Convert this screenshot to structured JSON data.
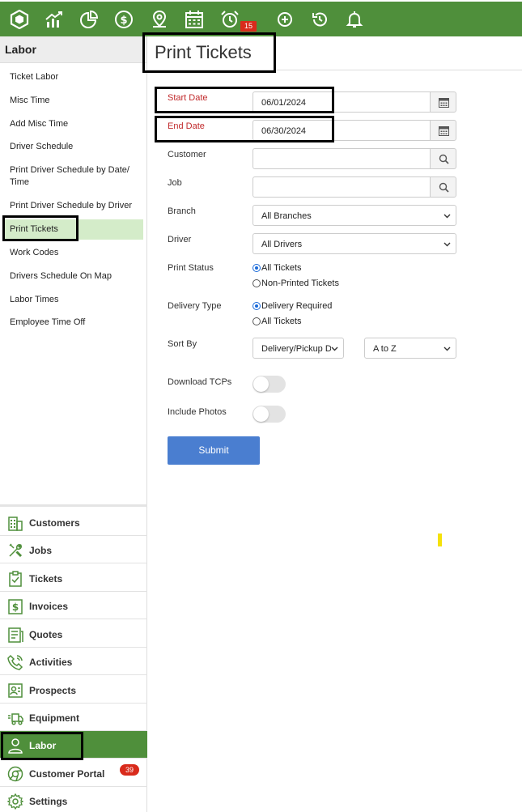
{
  "topbar": {
    "icons": [
      "logo-hexagon-icon",
      "chart-trend-icon",
      "pie-chart-icon",
      "dollar-circle-icon",
      "map-pin-icon",
      "calendar-icon",
      "alarm-clock-icon",
      "plus-circle-icon",
      "history-icon",
      "bell-icon"
    ],
    "alarm_badge": "15",
    "color": "#4f8f3b"
  },
  "sidebar": {
    "header": "Labor",
    "links": [
      "Ticket Labor",
      "Misc Time",
      "Add Misc Time",
      "Driver Schedule",
      "Print Driver Schedule by Date/ Time",
      "Print Driver Schedule by Driver",
      "Print Tickets",
      "Work Codes",
      "Drivers Schedule On Map",
      "Labor Times",
      "Employee Time Off"
    ],
    "active_link": "Print Tickets"
  },
  "modules": {
    "items": [
      "Customers",
      "Jobs",
      "Tickets",
      "Invoices",
      "Quotes",
      "Activities",
      "Prospects",
      "Equipment",
      "Labor",
      "Customer Portal",
      "Settings"
    ],
    "active": "Labor",
    "portal_badge": "39"
  },
  "main": {
    "title": "Print Tickets",
    "start_date_label": "Start Date",
    "start_date": "06/01/2024",
    "end_date_label": "End Date",
    "end_date": "06/30/2024",
    "customer_label": "Customer",
    "job_label": "Job",
    "branch_label": "Branch",
    "branch_value": "All Branches",
    "driver_label": "Driver",
    "driver_value": "All Drivers",
    "print_status_label": "Print Status",
    "print_status_options": [
      "All Tickets",
      "Non-Printed Tickets"
    ],
    "delivery_type_label": "Delivery Type",
    "delivery_type_options": [
      "Delivery Required",
      "All Tickets"
    ],
    "sort_by_label": "Sort By",
    "sort_by_value": "Delivery/Pickup Da",
    "sort_order_value": "A to Z",
    "download_tcps_label": "Download TCPs",
    "include_photos_label": "Include Photos",
    "submit_label": "Submit"
  },
  "colors": {
    "brand_green": "#4f8f3b",
    "active_link_bg": "#d4ecc9",
    "required_label": "#c0282a",
    "submit_blue": "#4a7ed0",
    "badge_red": "#d92b1c"
  }
}
